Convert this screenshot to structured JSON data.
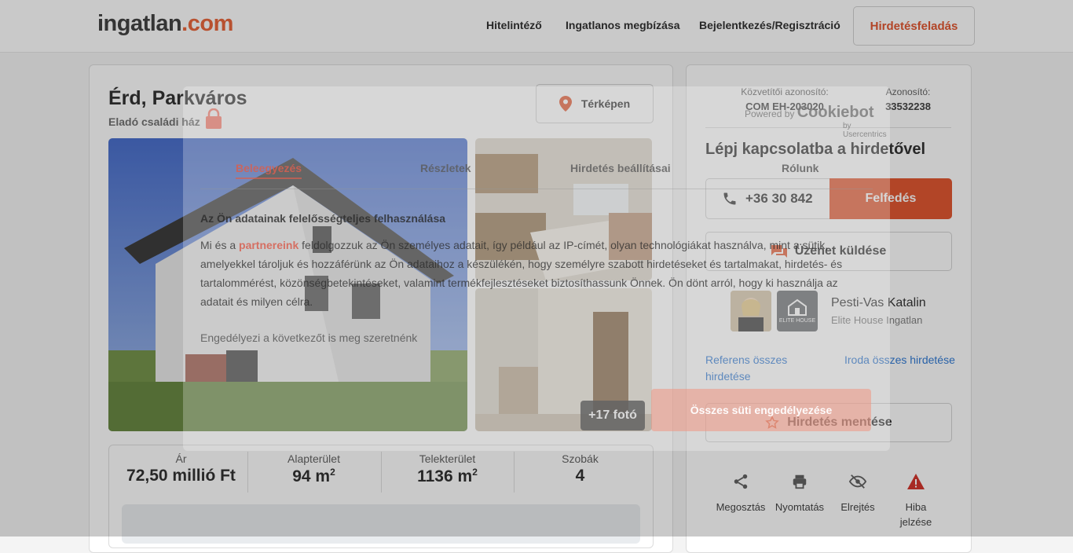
{
  "header": {
    "logo_main": "ingatlan",
    "logo_tld": ".com",
    "nav": [
      "Hitelintéző",
      "Ingatlanos megbízása",
      "Bejelentkezés/Regisztráció"
    ],
    "cta": "Hirdetésfeladás"
  },
  "listing": {
    "title": "Érd, Parkváros",
    "subtitle": "Eladó családi ház",
    "map_button": "Térképen",
    "more_photos": "+17 fotó",
    "stats": [
      {
        "label": "Ár",
        "value": "72,50 millió Ft",
        "sup": ""
      },
      {
        "label": "Alapterület",
        "value": "94 m",
        "sup": "2"
      },
      {
        "label": "Telekterület",
        "value": "1136 m",
        "sup": "2"
      },
      {
        "label": "Szobák",
        "value": "4",
        "sup": ""
      }
    ]
  },
  "sidebar": {
    "agency_id_label": "Közvetítői azonosító:",
    "agency_id": "COM EH-203020",
    "id_label": "Azonosító:",
    "id": "33532238",
    "contact_title": "Lépj kapcsolatba a hirdetővel",
    "phone": "+36 30 842",
    "reveal": "Felfedés",
    "message": "Üzenet küldése",
    "agent_name": "Pesti-Vas Katalin",
    "agent_office": "Elite House Ingatlan",
    "logo_text": "ELITE HOUSE",
    "link_agent": "Referens összes hirdetése",
    "link_office": "Iroda összes hirdetése",
    "save": "Hirdetés mentése",
    "actions": [
      {
        "label": "Megosztás",
        "icon": "share-icon"
      },
      {
        "label": "Nyomtatás",
        "icon": "print-icon"
      },
      {
        "label": "Elrejtés",
        "icon": "hide-icon"
      },
      {
        "label": "Hiba jelzése",
        "icon": "warning-icon"
      }
    ]
  },
  "cookie": {
    "powered": "Powered by",
    "brand": "Cookiebot",
    "by": "by Usercentrics",
    "tabs": [
      "Beleegyezés",
      "Részletek",
      "Hirdetés beállításai",
      "Rólunk"
    ],
    "heading": "Az Ön adatainak felelősségteljes felhasználása",
    "body_1": "Mi és a ",
    "body_link": "partnereink",
    "body_2": " feldolgozzuk az Ön személyes adatait, így például az IP-címét, olyan technológiákat használva, mint a sütik, amelyekkel tároljuk és hozzáférünk az Ön adataihoz a készülékén, hogy személyre szabott hirdetéseket és tartalmakat, hirdetés- és tartalommérést, közönségbetekintéseket, valamint termékfejlesztéseket biztosíthassunk Önnek. Ön dönt arról, hogy ki használja az adatait és milyen célra.",
    "note": "Engedélyezi a következőt is meg szeretnénk",
    "accept": "Összes süti engedélyezése"
  },
  "colors": {
    "brand": "#e0491f",
    "link": "#1f6fd1",
    "warning": "#d0231a"
  }
}
